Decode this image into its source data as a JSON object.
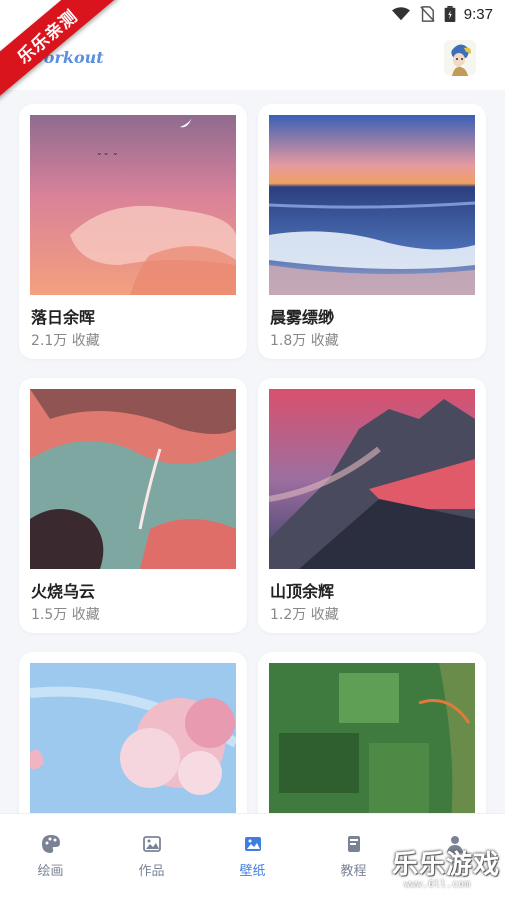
{
  "status_bar": {
    "time": "9:37"
  },
  "badge": {
    "text": "乐乐亲测"
  },
  "header": {
    "title": "workout"
  },
  "cards": [
    {
      "title": "落日余晖",
      "favorites": "2.1万 收藏"
    },
    {
      "title": "晨雾缥缈",
      "favorites": "1.8万 收藏"
    },
    {
      "title": "火烧乌云",
      "favorites": "1.5万 收藏"
    },
    {
      "title": "山顶余辉",
      "favorites": "1.2万 收藏"
    },
    {
      "title": "",
      "favorites": ""
    },
    {
      "title": "",
      "favorites": ""
    }
  ],
  "bottom_nav": {
    "items": [
      {
        "label": "绘画",
        "icon": "palette-icon"
      },
      {
        "label": "作品",
        "icon": "gallery-icon"
      },
      {
        "label": "壁纸",
        "icon": "image-icon"
      },
      {
        "label": "教程",
        "icon": "book-icon"
      },
      {
        "label": "",
        "icon": "user-icon"
      }
    ],
    "active": "壁纸"
  },
  "watermark": {
    "text": "乐乐游戏",
    "url": "www.6ll.com"
  },
  "colors": {
    "accent": "#3f7de0",
    "badge": "#d9141c",
    "inactive": "#7a8396"
  }
}
